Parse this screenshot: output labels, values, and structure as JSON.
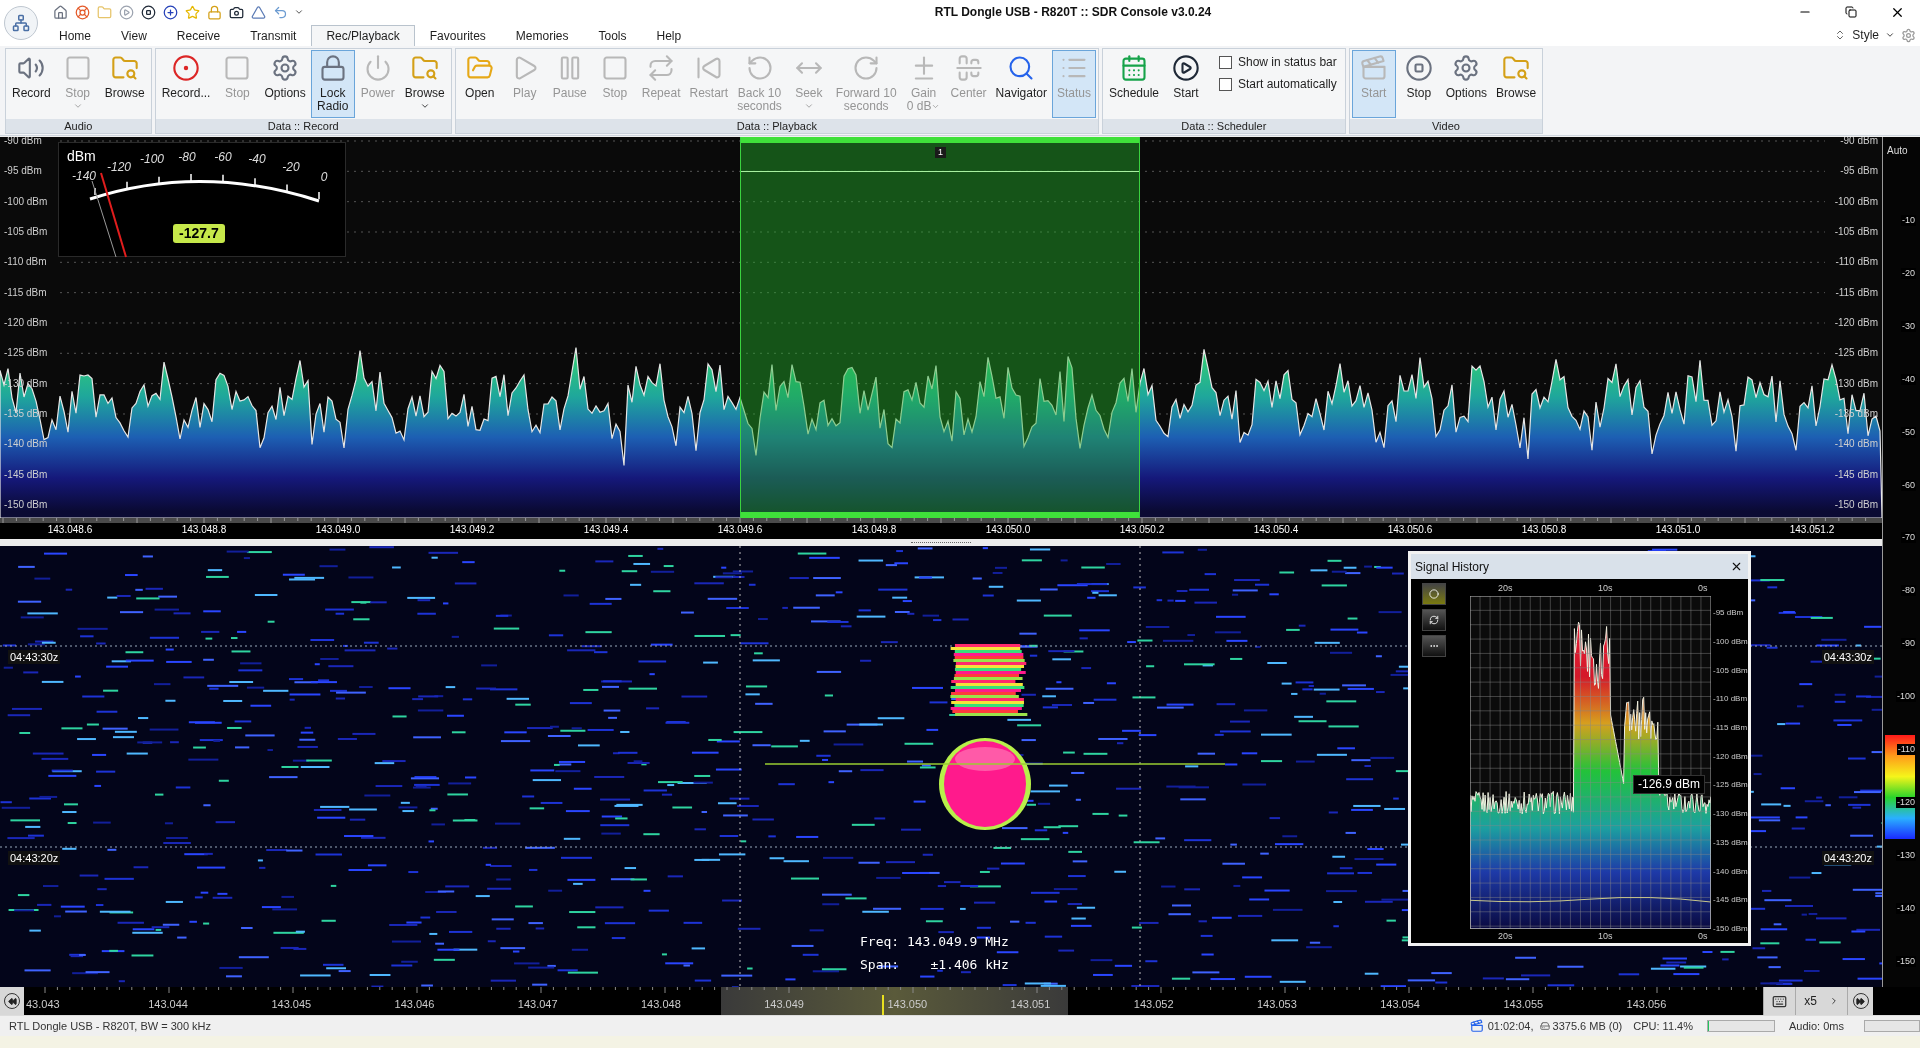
{
  "window": {
    "title": "RTL Dongle USB - R820T :: SDR Console v3.0.24"
  },
  "tabs": [
    {
      "label": "Home",
      "selected": false
    },
    {
      "label": "View",
      "selected": false
    },
    {
      "label": "Receive",
      "selected": false
    },
    {
      "label": "Transmit",
      "selected": false
    },
    {
      "label": "Rec/Playback",
      "selected": true
    },
    {
      "label": "Favourites",
      "selected": false
    },
    {
      "label": "Memories",
      "selected": false
    },
    {
      "label": "Tools",
      "selected": false
    },
    {
      "label": "Help",
      "selected": false
    }
  ],
  "style_menu": {
    "label": "Style"
  },
  "ribbon": {
    "groups": [
      {
        "title": "Audio",
        "items": [
          {
            "kind": "button",
            "label": "Record",
            "disabled": false,
            "selected": false,
            "dropdown": false
          },
          {
            "kind": "button",
            "label": "Stop",
            "disabled": true,
            "selected": false,
            "dropdown": true
          },
          {
            "kind": "button",
            "label": "Browse",
            "disabled": false,
            "selected": false,
            "dropdown": false
          }
        ]
      },
      {
        "title": "Data :: Record",
        "items": [
          {
            "kind": "button",
            "label": "Record...",
            "disabled": false,
            "selected": false,
            "dropdown": false
          },
          {
            "kind": "button",
            "label": "Stop",
            "disabled": true,
            "selected": false,
            "dropdown": false
          },
          {
            "kind": "button",
            "label": "Options",
            "disabled": false,
            "selected": false,
            "dropdown": false
          },
          {
            "kind": "button",
            "label": "Lock\nRadio",
            "disabled": false,
            "selected": true,
            "dropdown": false
          },
          {
            "kind": "button",
            "label": "Power",
            "disabled": true,
            "selected": false,
            "dropdown": false
          },
          {
            "kind": "button",
            "label": "Browse",
            "disabled": false,
            "selected": false,
            "dropdown": true
          }
        ]
      },
      {
        "title": "Data :: Playback",
        "items": [
          {
            "kind": "button",
            "label": "Open",
            "disabled": false,
            "selected": false,
            "dropdown": false
          },
          {
            "kind": "button",
            "label": "Play",
            "disabled": true,
            "selected": false,
            "dropdown": false
          },
          {
            "kind": "button",
            "label": "Pause",
            "disabled": true,
            "selected": false,
            "dropdown": false
          },
          {
            "kind": "button",
            "label": "Stop",
            "disabled": true,
            "selected": false,
            "dropdown": false
          },
          {
            "kind": "button",
            "label": "Repeat",
            "disabled": true,
            "selected": false,
            "dropdown": false
          },
          {
            "kind": "button",
            "label": "Restart",
            "disabled": true,
            "selected": false,
            "dropdown": false
          },
          {
            "kind": "button",
            "label": "Back 10\nseconds",
            "disabled": true,
            "selected": false,
            "dropdown": false
          },
          {
            "kind": "button",
            "label": "Seek",
            "disabled": true,
            "selected": false,
            "dropdown": true
          },
          {
            "kind": "button",
            "label": "Forward 10\nseconds",
            "disabled": true,
            "selected": false,
            "dropdown": false
          },
          {
            "kind": "button",
            "label": "Gain",
            "sub": "0 dB",
            "disabled": true,
            "selected": false,
            "dropdown": true
          },
          {
            "kind": "button",
            "label": "Center",
            "disabled": true,
            "selected": false,
            "dropdown": false
          },
          {
            "kind": "button",
            "label": "Navigator",
            "disabled": false,
            "selected": false,
            "dropdown": false
          },
          {
            "kind": "button",
            "label": "Status",
            "disabled": true,
            "selected": true,
            "dropdown": false
          }
        ]
      },
      {
        "title": "Data :: Scheduler",
        "items": [
          {
            "kind": "button",
            "label": "Schedule",
            "disabled": false,
            "selected": false,
            "dropdown": false
          },
          {
            "kind": "button",
            "label": "Start",
            "disabled": false,
            "selected": false,
            "dropdown": false
          },
          {
            "kind": "checkbox",
            "label": "Show in status bar",
            "checked": false
          },
          {
            "kind": "checkbox",
            "label": "Start automatically",
            "checked": false
          }
        ]
      },
      {
        "title": "Video",
        "items": [
          {
            "kind": "button",
            "label": "Start",
            "disabled": true,
            "selected": true,
            "dropdown": false
          },
          {
            "kind": "button",
            "label": "Stop",
            "disabled": false,
            "selected": false,
            "dropdown": false
          },
          {
            "kind": "button",
            "label": "Options",
            "disabled": false,
            "selected": false,
            "dropdown": false
          },
          {
            "kind": "button",
            "label": "Browse",
            "disabled": false,
            "selected": false,
            "dropdown": false
          }
        ]
      }
    ]
  },
  "spectrum": {
    "y_labels_left": [
      "-90 dBm",
      "-95 dBm",
      "-100 dBm",
      "-105 dBm",
      "-110 dBm",
      "-115 dBm",
      "-120 dBm",
      "-125 dBm",
      "-130 dBm",
      "-135 dBm",
      "-140 dBm",
      "-145 dBm",
      "-150 dBm"
    ],
    "y_labels_right": [
      "-90 dBm",
      "-95 dBm",
      "-100 dBm",
      "-105 dBm",
      "-110 dBm",
      "-115 dBm",
      "-120 dBm",
      "-125 dBm",
      "-130 dBm",
      "-135 dBm",
      "-140 dBm",
      "-145 dBm",
      "-150 dBm"
    ],
    "freq_labels": [
      "143.048.6",
      "143.048.8",
      "143.049.0",
      "143.049.2",
      "143.049.4",
      "143.049.6",
      "143.049.8",
      "143.050.0",
      "143.050.2",
      "143.050.4",
      "143.050.6",
      "143.050.8",
      "143.051.0",
      "143.051.2"
    ],
    "meter": {
      "unit": "dBm",
      "scale": [
        "-140",
        "-120",
        "-100",
        "-80",
        "-60",
        "-40",
        "-20",
        "0"
      ],
      "reading": "-127.7"
    },
    "passband": {
      "label": "1"
    }
  },
  "side_scale": {
    "label": "Auto",
    "ticks": [
      "-10",
      "-20",
      "-30",
      "-40",
      "-50",
      "-60",
      "-70",
      "-80",
      "-90",
      "-100",
      "-110",
      "-120",
      "-130",
      "-140",
      "-150"
    ]
  },
  "waterfall": {
    "time_labels_left": [
      "04:43:30z",
      "04:43:20z"
    ],
    "time_labels_right": [
      "04:43:30z",
      "04:43:20z"
    ],
    "freq": "Freq: 143.049.9 MHz",
    "span": "Span:    ±1.406 kHz"
  },
  "signal_history": {
    "title": "Signal History",
    "tool_buttons": [
      {
        "selected": true
      },
      {
        "selected": false
      },
      {
        "selected": false
      }
    ],
    "x_labels_top": [
      "20s",
      "10s",
      "0s"
    ],
    "x_labels_bottom": [
      "20s",
      "10s",
      "0s"
    ],
    "y_labels": [
      "-95 dBm",
      "-100 dBm",
      "-105 dBm",
      "-110 dBm",
      "-115 dBm",
      "-120 dBm",
      "-125 dBm",
      "-130 dBm",
      "-135 dBm",
      "-140 dBm",
      "-145 dBm",
      "-150 dBm"
    ],
    "tooltip": "-126.9 dBm"
  },
  "freq_axis": {
    "labels": [
      "43.043",
      "143.044",
      "143.045",
      "143.046",
      "143.047",
      "143.048",
      "143.049",
      "143.050",
      "143.051",
      "143.052",
      "143.053",
      "143.054",
      "143.055",
      "143.056"
    ],
    "zoom": "x5"
  },
  "status_bar": {
    "left": "RTL Dongle USB - R820T, BW = 300 kHz",
    "time": "01:02:04,",
    "disk": "3375.6 MB (0)",
    "cpu": "CPU: 11.4%",
    "cpu_meter": {
      "level": 0.02
    },
    "audio": "Audio: 0ms",
    "audio_meter": {
      "level": 0
    }
  }
}
